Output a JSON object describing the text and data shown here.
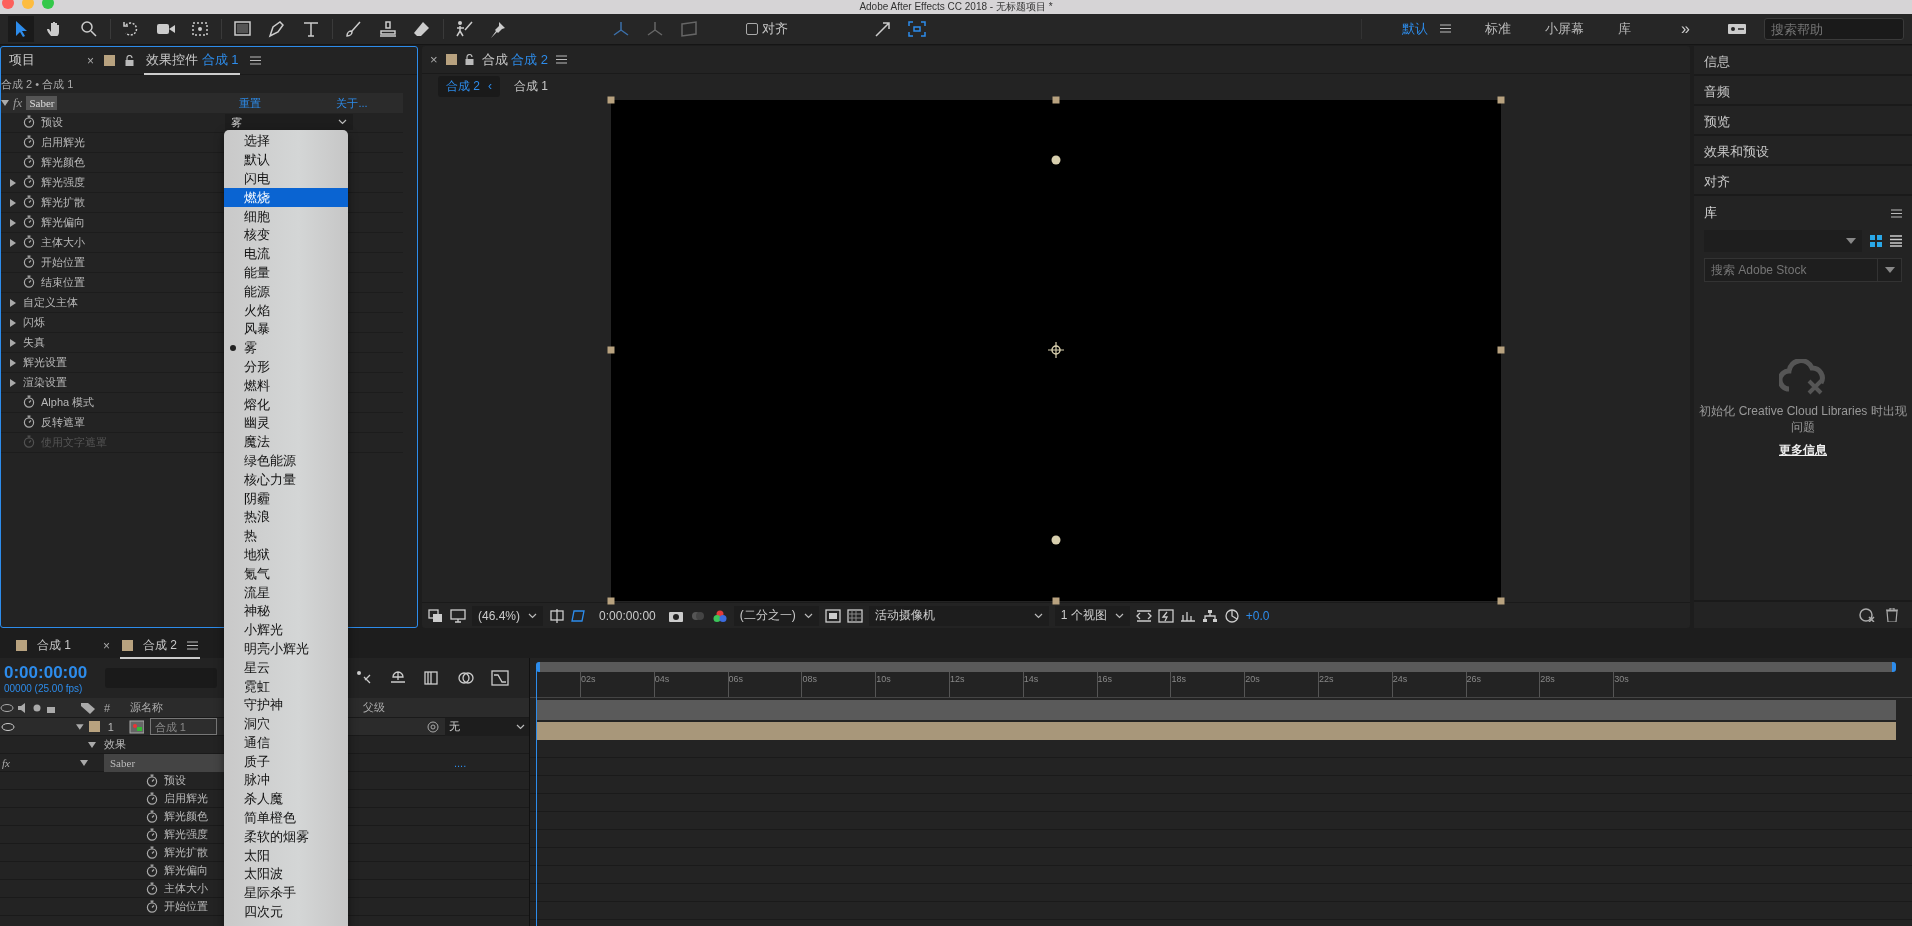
{
  "window": {
    "title": "Adobe After Effects CC 2018 - 无标题项目 *"
  },
  "toolbar": {
    "snap": {
      "label": "对齐",
      "checked": false
    },
    "workspaces": [
      {
        "label": "默认",
        "selected": true
      },
      {
        "label": "标准",
        "selected": false
      },
      {
        "label": "小屏幕",
        "selected": false
      },
      {
        "label": "库",
        "selected": false
      }
    ],
    "more": "»",
    "search": {
      "placeholder": "搜索帮助"
    }
  },
  "effect_controls": {
    "close": "×",
    "tabs": [
      {
        "label": "项目",
        "selected": false
      },
      {
        "label": "效果控件",
        "comp": "合成 1",
        "selected": true
      }
    ],
    "breadcrumb": "合成 2 • 合成 1",
    "effect": {
      "badge": "fx",
      "name": "Saber",
      "reset": "重置",
      "about": "关于..."
    },
    "rows": [
      {
        "kind": "property",
        "label": "预设",
        "expandable": false,
        "disabled": false,
        "value": "雾"
      },
      {
        "kind": "property",
        "label": "启用辉光",
        "expandable": false,
        "disabled": false
      },
      {
        "kind": "property",
        "label": "辉光颜色",
        "expandable": false,
        "disabled": false
      },
      {
        "kind": "property",
        "label": "辉光强度",
        "expandable": true,
        "disabled": false
      },
      {
        "kind": "property",
        "label": "辉光扩散",
        "expandable": true,
        "disabled": false
      },
      {
        "kind": "property",
        "label": "辉光偏向",
        "expandable": true,
        "disabled": false
      },
      {
        "kind": "property",
        "label": "主体大小",
        "expandable": true,
        "disabled": false
      },
      {
        "kind": "property",
        "label": "开始位置",
        "expandable": false,
        "disabled": false
      },
      {
        "kind": "property",
        "label": "结束位置",
        "expandable": false,
        "disabled": false
      },
      {
        "kind": "group",
        "label": "自定义主体"
      },
      {
        "kind": "group",
        "label": "闪烁"
      },
      {
        "kind": "group",
        "label": "失真"
      },
      {
        "kind": "group",
        "label": "辉光设置"
      },
      {
        "kind": "group",
        "label": "渲染设置"
      },
      {
        "kind": "property",
        "label": "Alpha 模式",
        "expandable": false,
        "disabled": false
      },
      {
        "kind": "property",
        "label": "反转遮罩",
        "expandable": false,
        "disabled": false
      },
      {
        "kind": "property",
        "label": "使用文字遮罩",
        "expandable": false,
        "disabled": true
      }
    ]
  },
  "viewer": {
    "header": {
      "close": "×",
      "label": "合成",
      "comp": "合成 2"
    },
    "tabs": [
      {
        "label": "合成 2",
        "selected": true,
        "nav": "‹"
      },
      {
        "label": "合成 1",
        "selected": false
      }
    ],
    "bottom_bar": {
      "zoom": "(46.4%)",
      "timecode": "0:00:00:00",
      "resolution": "(二分之一)",
      "camera": "活动摄像机",
      "views": "1 个视图",
      "exposure": "+0.0"
    }
  },
  "right_panel": {
    "panels": [
      "信息",
      "音频",
      "预览",
      "效果和预设",
      "对齐"
    ],
    "library": {
      "title": "库",
      "search_placeholder": "搜索 Adobe Stock",
      "message": "初始化 Creative Cloud Libraries 时出现问题",
      "link": "更多信息"
    }
  },
  "timeline": {
    "tabs": [
      {
        "label": "合成 1",
        "selected": false
      },
      {
        "label": "合成 2",
        "selected": true,
        "close": "×"
      }
    ],
    "timecode": "0:00:00:00",
    "frame_info": "00000 (25.00 fps)",
    "columns": {
      "number": "#",
      "source_name": "源名称",
      "parent": "父级"
    },
    "layer": {
      "number": "1",
      "name": "合成 1",
      "parent": "无"
    },
    "effects_label": "效果",
    "fx": "fx",
    "effect_name": "Saber",
    "effect_link": "....",
    "properties": [
      "预设",
      "启用辉光",
      "辉光颜色",
      "辉光强度",
      "辉光扩散",
      "辉光偏向",
      "主体大小",
      "开始位置"
    ],
    "ruler": [
      "02s",
      "04s",
      "06s",
      "08s",
      "10s",
      "12s",
      "14s",
      "16s",
      "18s",
      "20s",
      "22s",
      "24s",
      "26s",
      "28s",
      "30s"
    ]
  },
  "preset_menu": {
    "items": [
      {
        "label": "选择",
        "selected": false,
        "checked": false
      },
      {
        "label": "默认",
        "selected": false,
        "checked": false
      },
      {
        "label": "闪电",
        "selected": false,
        "checked": false
      },
      {
        "label": "燃烧",
        "selected": true,
        "checked": false
      },
      {
        "label": "细胞",
        "selected": false,
        "checked": false
      },
      {
        "label": "核变",
        "selected": false,
        "checked": false
      },
      {
        "label": "电流",
        "selected": false,
        "checked": false
      },
      {
        "label": "能量",
        "selected": false,
        "checked": false
      },
      {
        "label": "能源",
        "selected": false,
        "checked": false
      },
      {
        "label": "火焰",
        "selected": false,
        "checked": false
      },
      {
        "label": "风暴",
        "selected": false,
        "checked": false
      },
      {
        "label": "雾",
        "selected": false,
        "checked": true
      },
      {
        "label": "分形",
        "selected": false,
        "checked": false
      },
      {
        "label": "燃料",
        "selected": false,
        "checked": false
      },
      {
        "label": "熔化",
        "selected": false,
        "checked": false
      },
      {
        "label": "幽灵",
        "selected": false,
        "checked": false
      },
      {
        "label": "魔法",
        "selected": false,
        "checked": false
      },
      {
        "label": "绿色能源",
        "selected": false,
        "checked": false
      },
      {
        "label": "核心力量",
        "selected": false,
        "checked": false
      },
      {
        "label": "阴霾",
        "selected": false,
        "checked": false
      },
      {
        "label": "热浪",
        "selected": false,
        "checked": false
      },
      {
        "label": "热",
        "selected": false,
        "checked": false
      },
      {
        "label": "地狱",
        "selected": false,
        "checked": false
      },
      {
        "label": "氪气",
        "selected": false,
        "checked": false
      },
      {
        "label": "流星",
        "selected": false,
        "checked": false
      },
      {
        "label": "神秘",
        "selected": false,
        "checked": false
      },
      {
        "label": "小辉光",
        "selected": false,
        "checked": false
      },
      {
        "label": "明亮小辉光",
        "selected": false,
        "checked": false
      },
      {
        "label": "星云",
        "selected": false,
        "checked": false
      },
      {
        "label": "霓虹",
        "selected": false,
        "checked": false
      },
      {
        "label": "守护神",
        "selected": false,
        "checked": false
      },
      {
        "label": "洞穴",
        "selected": false,
        "checked": false
      },
      {
        "label": "通信",
        "selected": false,
        "checked": false
      },
      {
        "label": "质子",
        "selected": false,
        "checked": false
      },
      {
        "label": "脉冲",
        "selected": false,
        "checked": false
      },
      {
        "label": "杀人魔",
        "selected": false,
        "checked": false
      },
      {
        "label": "简单橙色",
        "selected": false,
        "checked": false
      },
      {
        "label": "柔软的烟雾",
        "selected": false,
        "checked": false
      },
      {
        "label": "太阳",
        "selected": false,
        "checked": false
      },
      {
        "label": "太阳波",
        "selected": false,
        "checked": false
      },
      {
        "label": "星际杀手",
        "selected": false,
        "checked": false
      },
      {
        "label": "四次元",
        "selected": false,
        "checked": false
      }
    ]
  }
}
